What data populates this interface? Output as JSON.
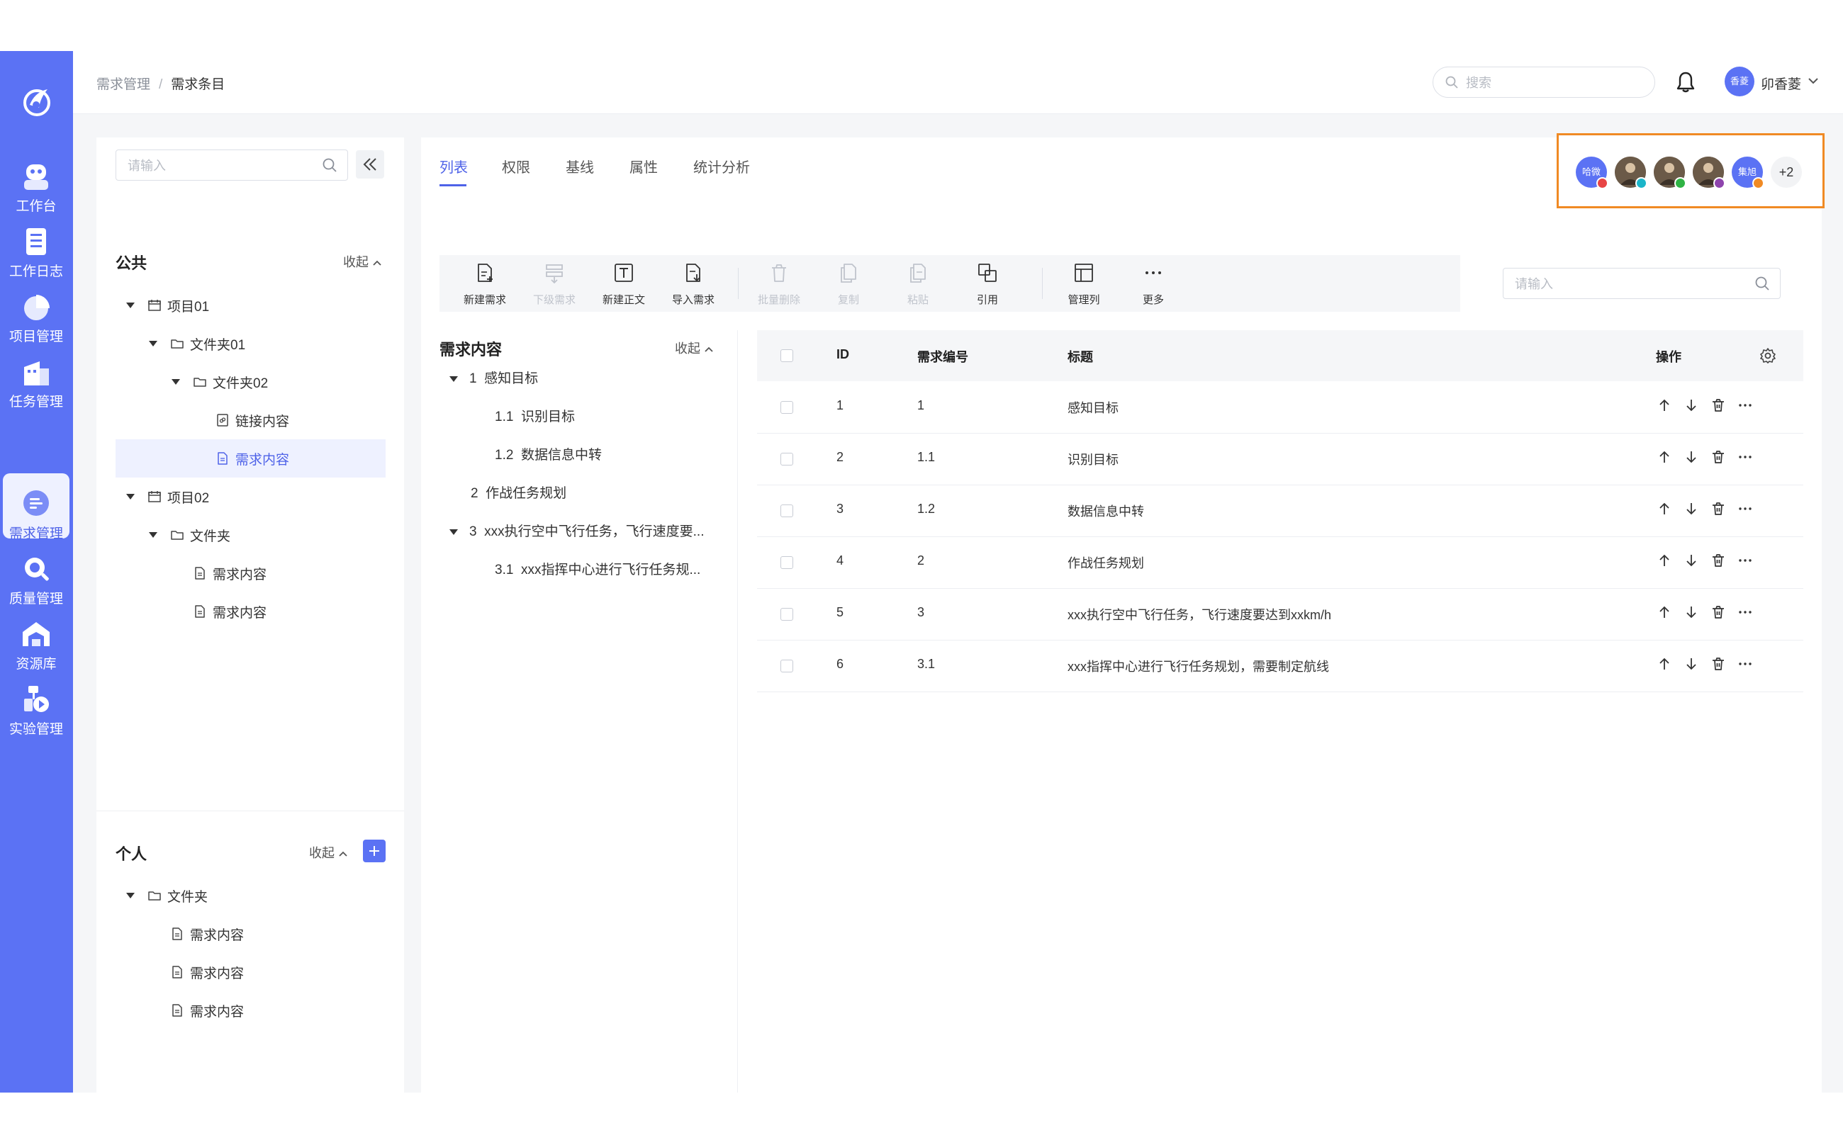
{
  "sidebar": {
    "items": [
      {
        "label": "工作台",
        "icon": "robot-icon"
      },
      {
        "label": "工作日志",
        "icon": "log-icon"
      },
      {
        "label": "项目管理",
        "icon": "pie-chart-icon"
      },
      {
        "label": "任务管理",
        "icon": "building-icon"
      },
      {
        "label": "需求管理",
        "icon": "requirement-icon",
        "active": true
      },
      {
        "label": "质量管理",
        "icon": "magnifier-icon"
      },
      {
        "label": "资源库",
        "icon": "warehouse-icon"
      },
      {
        "label": "实验管理",
        "icon": "experiment-icon"
      }
    ],
    "bg_color": "#5b72f4"
  },
  "header": {
    "breadcrumb": [
      "需求管理",
      "需求条目"
    ],
    "breadcrumb_sep": "/",
    "search_placeholder": "搜索",
    "user_avatar_text": "香菱",
    "user_name": "卯香菱"
  },
  "left_panel": {
    "search_placeholder": "请输入",
    "public_title": "公共",
    "collapse_label": "收起",
    "public_tree": [
      {
        "label": "项目01",
        "icon": "project-icon"
      },
      {
        "label": "文件夹01",
        "icon": "folder-icon"
      },
      {
        "label": "文件夹02",
        "icon": "folder-icon"
      },
      {
        "label": "链接内容",
        "icon": "link-doc-icon"
      },
      {
        "label": "需求内容",
        "icon": "doc-icon",
        "selected": true
      },
      {
        "label": "项目02",
        "icon": "project-icon"
      },
      {
        "label": "文件夹",
        "icon": "folder-icon"
      },
      {
        "label": "需求内容",
        "icon": "doc-icon"
      },
      {
        "label": "需求内容",
        "icon": "doc-icon"
      }
    ],
    "personal_title": "个人",
    "personal_tree": [
      {
        "label": "文件夹",
        "icon": "folder-icon"
      },
      {
        "label": "需求内容",
        "icon": "doc-icon"
      },
      {
        "label": "需求内容",
        "icon": "doc-icon"
      },
      {
        "label": "需求内容",
        "icon": "doc-icon"
      }
    ]
  },
  "main": {
    "tabs": [
      "列表",
      "权限",
      "基线",
      "属性",
      "统计分析"
    ],
    "active_tab": "列表",
    "collaborators": [
      {
        "text": "哈微",
        "status_color": "#e84545"
      },
      {
        "text": "",
        "status_color": "#1bb5c9"
      },
      {
        "text": "",
        "status_color": "#2fb344"
      },
      {
        "text": "",
        "status_color": "#8e44ad"
      },
      {
        "text": "集旭",
        "status_color": "#f08a24"
      }
    ],
    "more_collaborators": "+2",
    "toolbar": [
      {
        "label": "新建需求",
        "disabled": false
      },
      {
        "label": "下级需求",
        "disabled": true
      },
      {
        "label": "新建正文",
        "disabled": false
      },
      {
        "label": "导入需求",
        "disabled": false
      },
      {
        "label": "批量删除",
        "disabled": true
      },
      {
        "label": "复制",
        "disabled": true
      },
      {
        "label": "粘贴",
        "disabled": true
      },
      {
        "label": "引用",
        "disabled": false
      },
      {
        "label": "管理列",
        "disabled": false
      },
      {
        "label": "更多",
        "disabled": false
      }
    ],
    "search_placeholder": "请输入",
    "outline": {
      "title": "需求内容",
      "collapse_label": "收起",
      "items": [
        {
          "num": "1",
          "text": "感知目标"
        },
        {
          "num": "1.1",
          "text": "识别目标"
        },
        {
          "num": "1.2",
          "text": "数据信息中转"
        },
        {
          "num": "2",
          "text": "作战任务规划"
        },
        {
          "num": "3",
          "text": "xxx执行空中飞行任务，飞行速度要..."
        },
        {
          "num": "3.1",
          "text": "xxx指挥中心进行飞行任务规..."
        }
      ]
    },
    "table": {
      "headers": {
        "id": "ID",
        "code": "需求编号",
        "title": "标题",
        "ops": "操作"
      },
      "rows": [
        {
          "id": "1",
          "code": "1",
          "title": "感知目标"
        },
        {
          "id": "2",
          "code": "1.1",
          "title": "识别目标"
        },
        {
          "id": "3",
          "code": "1.2",
          "title": "数据信息中转"
        },
        {
          "id": "4",
          "code": "2",
          "title": "作战任务规划"
        },
        {
          "id": "5",
          "code": "3",
          "title": "xxx执行空中飞行任务，飞行速度要达到xxkm/h"
        },
        {
          "id": "6",
          "code": "3.1",
          "title": "xxx指挥中心进行飞行任务规划，需要制定航线"
        }
      ]
    }
  },
  "colors": {
    "accent": "#4e62e8",
    "highlight_border": "#f08a24"
  }
}
